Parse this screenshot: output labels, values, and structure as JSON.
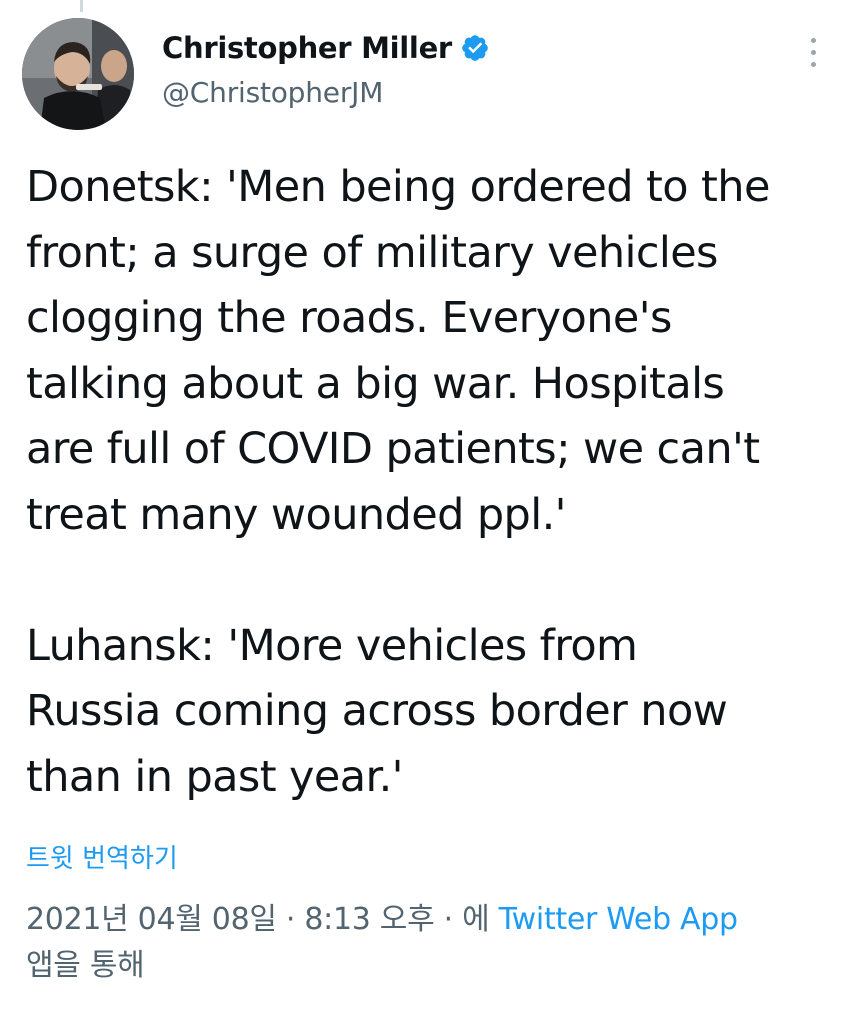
{
  "author": {
    "display_name": "Christopher Miller",
    "handle": "@ChristopherJM",
    "verified": true
  },
  "tweet": {
    "text": "Donetsk: 'Men being ordered to the\nfront; a surge of military vehicles\nclogging the roads. Everyone's\ntalking about a big war. Hospitals\nare full of COVID patients; we can't\ntreat many wounded ppl.'\n\nLuhansk: 'More vehicles from\nRussia coming across border now\nthan in past year.'"
  },
  "translate_label": "트윗 번역하기",
  "meta": {
    "date_time": "2021년 04월 08일 · 8:13 오후 · 에 ",
    "source": "Twitter Web App",
    "suffix": "앱을 통해"
  },
  "icons": {
    "verified": "verified-badge-icon",
    "more": "more-vertical-icon"
  },
  "colors": {
    "accent": "#1d9bf0",
    "secondary_text": "#536471",
    "primary_text": "#0f1419"
  }
}
